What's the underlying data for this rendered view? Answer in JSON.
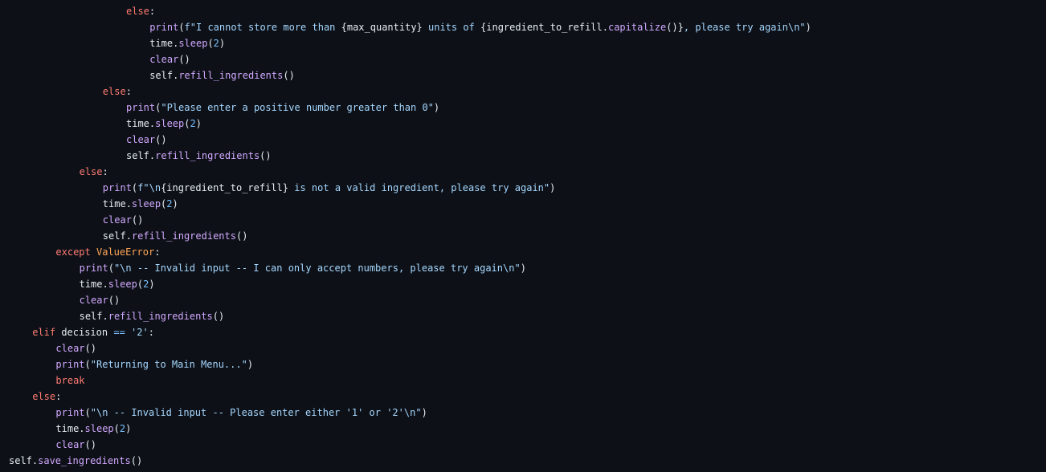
{
  "theme": {
    "background": "#0d1117",
    "colors": {
      "default": "#e6edf3",
      "keyword": "#ff7b72",
      "string": "#a5d6ff",
      "function": "#d2a8ff",
      "number": "#79c0ff",
      "operator": "#79c0ff",
      "class": "#ffa657"
    }
  },
  "editor": {
    "language": "python",
    "lines": [
      {
        "indent": 20,
        "tokens": [
          {
            "t": "else",
            "k": "keyword"
          },
          {
            "t": ":",
            "k": "default"
          }
        ]
      },
      {
        "indent": 24,
        "tokens": [
          {
            "t": "print",
            "k": "function"
          },
          {
            "t": "(",
            "k": "default"
          },
          {
            "t": "f\"I cannot store more than ",
            "k": "string"
          },
          {
            "t": "{max_quantity}",
            "k": "default"
          },
          {
            "t": " units of ",
            "k": "string"
          },
          {
            "t": "{ingredient_to_refill.",
            "k": "default"
          },
          {
            "t": "capitalize",
            "k": "function"
          },
          {
            "t": "()}",
            "k": "default"
          },
          {
            "t": ", please try again\\n\"",
            "k": "string"
          },
          {
            "t": ")",
            "k": "default"
          }
        ]
      },
      {
        "indent": 24,
        "tokens": [
          {
            "t": "time.",
            "k": "default"
          },
          {
            "t": "sleep",
            "k": "function"
          },
          {
            "t": "(",
            "k": "default"
          },
          {
            "t": "2",
            "k": "number"
          },
          {
            "t": ")",
            "k": "default"
          }
        ]
      },
      {
        "indent": 24,
        "tokens": [
          {
            "t": "clear",
            "k": "function"
          },
          {
            "t": "()",
            "k": "default"
          }
        ]
      },
      {
        "indent": 24,
        "tokens": [
          {
            "t": "self.",
            "k": "default"
          },
          {
            "t": "refill_ingredients",
            "k": "function"
          },
          {
            "t": "()",
            "k": "default"
          }
        ]
      },
      {
        "indent": 16,
        "tokens": [
          {
            "t": "else",
            "k": "keyword"
          },
          {
            "t": ":",
            "k": "default"
          }
        ]
      },
      {
        "indent": 20,
        "tokens": [
          {
            "t": "print",
            "k": "function"
          },
          {
            "t": "(",
            "k": "default"
          },
          {
            "t": "\"Please enter a positive number greater than 0\"",
            "k": "string"
          },
          {
            "t": ")",
            "k": "default"
          }
        ]
      },
      {
        "indent": 20,
        "tokens": [
          {
            "t": "time.",
            "k": "default"
          },
          {
            "t": "sleep",
            "k": "function"
          },
          {
            "t": "(",
            "k": "default"
          },
          {
            "t": "2",
            "k": "number"
          },
          {
            "t": ")",
            "k": "default"
          }
        ]
      },
      {
        "indent": 20,
        "tokens": [
          {
            "t": "clear",
            "k": "function"
          },
          {
            "t": "()",
            "k": "default"
          }
        ]
      },
      {
        "indent": 20,
        "tokens": [
          {
            "t": "self.",
            "k": "default"
          },
          {
            "t": "refill_ingredients",
            "k": "function"
          },
          {
            "t": "()",
            "k": "default"
          }
        ]
      },
      {
        "indent": 12,
        "tokens": [
          {
            "t": "else",
            "k": "keyword"
          },
          {
            "t": ":",
            "k": "default"
          }
        ]
      },
      {
        "indent": 16,
        "tokens": [
          {
            "t": "print",
            "k": "function"
          },
          {
            "t": "(",
            "k": "default"
          },
          {
            "t": "f\"\\n",
            "k": "string"
          },
          {
            "t": "{ingredient_to_refill}",
            "k": "default"
          },
          {
            "t": " is not a valid ingredient, please try again\"",
            "k": "string"
          },
          {
            "t": ")",
            "k": "default"
          }
        ]
      },
      {
        "indent": 16,
        "tokens": [
          {
            "t": "time.",
            "k": "default"
          },
          {
            "t": "sleep",
            "k": "function"
          },
          {
            "t": "(",
            "k": "default"
          },
          {
            "t": "2",
            "k": "number"
          },
          {
            "t": ")",
            "k": "default"
          }
        ]
      },
      {
        "indent": 16,
        "tokens": [
          {
            "t": "clear",
            "k": "function"
          },
          {
            "t": "()",
            "k": "default"
          }
        ]
      },
      {
        "indent": 16,
        "tokens": [
          {
            "t": "self.",
            "k": "default"
          },
          {
            "t": "refill_ingredients",
            "k": "function"
          },
          {
            "t": "()",
            "k": "default"
          }
        ]
      },
      {
        "indent": 8,
        "tokens": [
          {
            "t": "except ",
            "k": "keyword"
          },
          {
            "t": "ValueError",
            "k": "class"
          },
          {
            "t": ":",
            "k": "default"
          }
        ]
      },
      {
        "indent": 12,
        "tokens": [
          {
            "t": "print",
            "k": "function"
          },
          {
            "t": "(",
            "k": "default"
          },
          {
            "t": "\"\\n -- Invalid input -- I can only accept numbers, please try again\\n\"",
            "k": "string"
          },
          {
            "t": ")",
            "k": "default"
          }
        ]
      },
      {
        "indent": 12,
        "tokens": [
          {
            "t": "time.",
            "k": "default"
          },
          {
            "t": "sleep",
            "k": "function"
          },
          {
            "t": "(",
            "k": "default"
          },
          {
            "t": "2",
            "k": "number"
          },
          {
            "t": ")",
            "k": "default"
          }
        ]
      },
      {
        "indent": 12,
        "tokens": [
          {
            "t": "clear",
            "k": "function"
          },
          {
            "t": "()",
            "k": "default"
          }
        ]
      },
      {
        "indent": 12,
        "tokens": [
          {
            "t": "self.",
            "k": "default"
          },
          {
            "t": "refill_ingredients",
            "k": "function"
          },
          {
            "t": "()",
            "k": "default"
          }
        ]
      },
      {
        "indent": 4,
        "tokens": [
          {
            "t": "elif ",
            "k": "keyword"
          },
          {
            "t": "decision ",
            "k": "default"
          },
          {
            "t": "==",
            "k": "operator"
          },
          {
            "t": " ",
            "k": "default"
          },
          {
            "t": "'2'",
            "k": "string"
          },
          {
            "t": ":",
            "k": "default"
          }
        ]
      },
      {
        "indent": 8,
        "tokens": [
          {
            "t": "clear",
            "k": "function"
          },
          {
            "t": "()",
            "k": "default"
          }
        ]
      },
      {
        "indent": 8,
        "tokens": [
          {
            "t": "print",
            "k": "function"
          },
          {
            "t": "(",
            "k": "default"
          },
          {
            "t": "\"Returning to Main Menu...\"",
            "k": "string"
          },
          {
            "t": ")",
            "k": "default"
          }
        ]
      },
      {
        "indent": 8,
        "tokens": [
          {
            "t": "break",
            "k": "keyword"
          }
        ]
      },
      {
        "indent": 4,
        "tokens": [
          {
            "t": "else",
            "k": "keyword"
          },
          {
            "t": ":",
            "k": "default"
          }
        ]
      },
      {
        "indent": 8,
        "tokens": [
          {
            "t": "print",
            "k": "function"
          },
          {
            "t": "(",
            "k": "default"
          },
          {
            "t": "\"\\n -- Invalid input -- Please enter either '1' or '2'\\n\"",
            "k": "string"
          },
          {
            "t": ")",
            "k": "default"
          }
        ]
      },
      {
        "indent": 8,
        "tokens": [
          {
            "t": "time.",
            "k": "default"
          },
          {
            "t": "sleep",
            "k": "function"
          },
          {
            "t": "(",
            "k": "default"
          },
          {
            "t": "2",
            "k": "number"
          },
          {
            "t": ")",
            "k": "default"
          }
        ]
      },
      {
        "indent": 8,
        "tokens": [
          {
            "t": "clear",
            "k": "function"
          },
          {
            "t": "()",
            "k": "default"
          }
        ]
      },
      {
        "indent": 0,
        "tokens": [
          {
            "t": "self.",
            "k": "default"
          },
          {
            "t": "save_ingredients",
            "k": "function"
          },
          {
            "t": "()",
            "k": "default"
          }
        ]
      }
    ]
  }
}
